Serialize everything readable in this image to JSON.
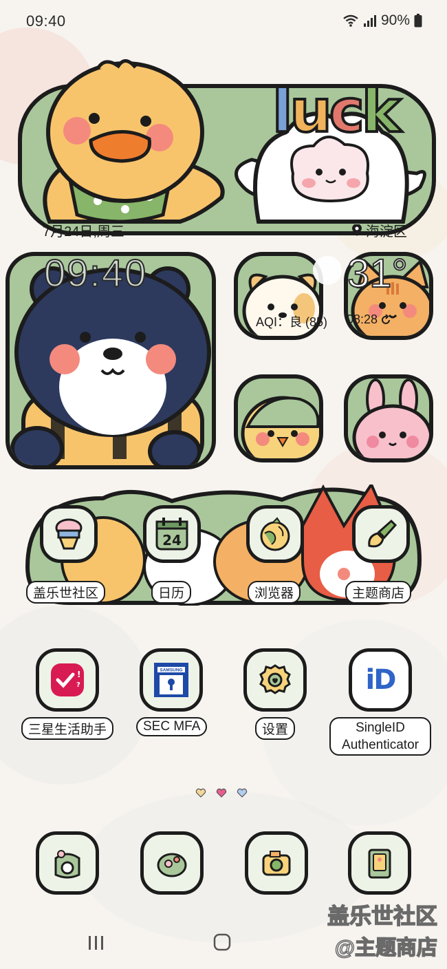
{
  "status_bar": {
    "time": "09:40",
    "battery": "90%"
  },
  "banner": {
    "letters": [
      "l",
      "u",
      "c",
      "k"
    ],
    "colors": [
      "#7aa0d6",
      "#f0b35b",
      "#e2786d",
      "#87b569"
    ]
  },
  "widget": {
    "date": "7月24日,周三",
    "location": "海淀区",
    "clock": "09:40",
    "temperature": "31°",
    "aqi": "AQI：良 (85)",
    "updated": "08:28"
  },
  "strip_apps": [
    {
      "label": "盖乐世社区"
    },
    {
      "label": "日历",
      "calendar_day": "24"
    },
    {
      "label": "浏览器"
    },
    {
      "label": "主题商店"
    }
  ],
  "apps": [
    {
      "label": "三星生活助手"
    },
    {
      "label": "SEC MFA",
      "badge_text": "SAMSUNG"
    },
    {
      "label": "设置"
    },
    {
      "label": "SingleID Authenticator",
      "icon_text": "iD"
    }
  ],
  "page_indicator": {
    "pages": 3,
    "active": 1
  },
  "dock": {
    "icons": [
      "camera-bag-icon",
      "flower-cup-icon",
      "photo-camera-icon",
      "gallery-icon"
    ]
  },
  "watermark": {
    "line1": "盖乐世社区",
    "line2": "@主题商店"
  }
}
